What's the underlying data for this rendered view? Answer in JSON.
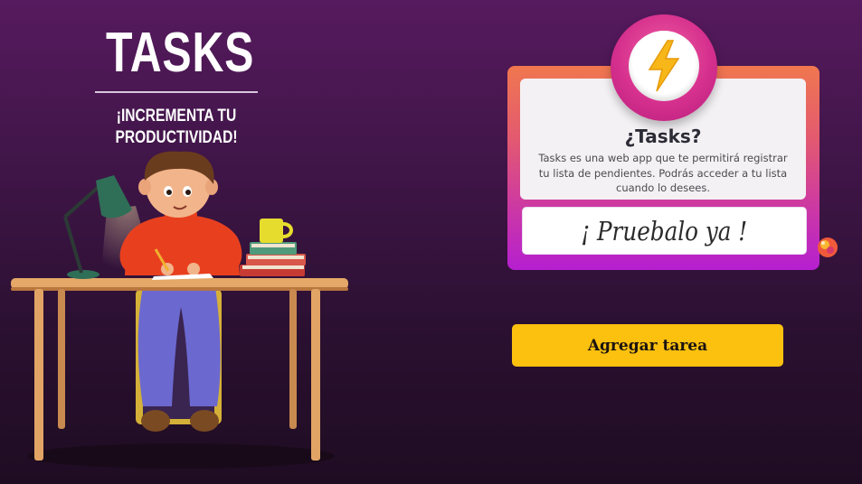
{
  "hero": {
    "title": "TASKS",
    "subtitle": "¡INCREMENTA TU PRODUCTIVIDAD!"
  },
  "illustration": {
    "description_icon": "person-at-desk-illustration"
  },
  "card": {
    "badge_icon": "lightning-bolt-icon",
    "heading": "¿Tasks?",
    "description": "Tasks es una web app que te permitirá registrar tu lista de pendientes. Podrás acceder a tu lista cuando lo desees.",
    "cta_label": "¡ Pruebalo ya !"
  },
  "actions": {
    "add_task_label": "Agregar tarea"
  },
  "colors": {
    "background_top": "#561a5e",
    "background_bottom": "#1f0c22",
    "card_gradient_top": "#f0774f",
    "card_gradient_bottom": "#b51fd0",
    "button_yellow": "#fcc00f",
    "bolt_yellow": "#f7b718"
  }
}
